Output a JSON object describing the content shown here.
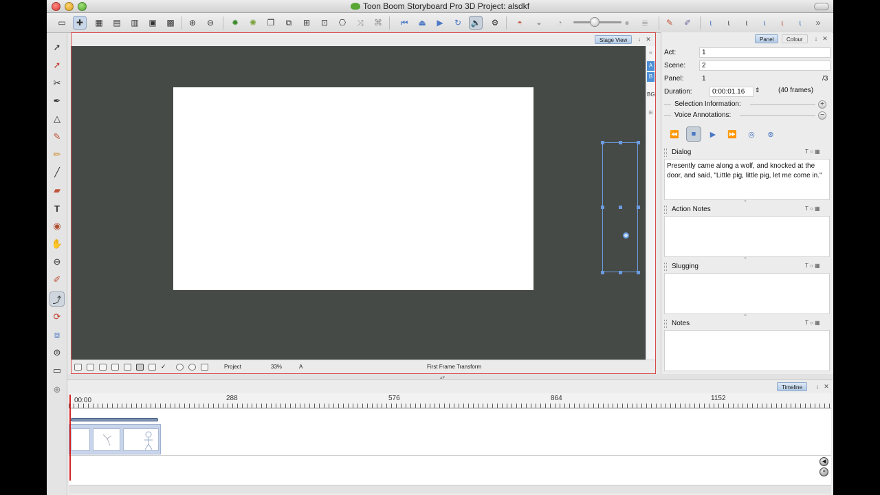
{
  "window": {
    "title": "Toon Boom Storyboard Pro 3D Project: alsdkf"
  },
  "stage_view": {
    "tab_label": "Stage View",
    "status": {
      "display": "Project",
      "zoom": "33%",
      "layer": "A",
      "transform_mode": "First Frame Transform"
    },
    "side_tabs": [
      "A",
      "B",
      "BG"
    ]
  },
  "right_panel": {
    "tabs": {
      "panel": "Panel",
      "colour": "Colour"
    },
    "fields": {
      "act_label": "Act:",
      "act_value": "1",
      "scene_label": "Scene:",
      "scene_value": "2",
      "panel_label": "Panel:",
      "panel_value": "1",
      "panel_total": "/3",
      "duration_label": "Duration:",
      "duration_value": "0:00:01.16",
      "frames_text": "(40 frames)"
    },
    "selection_information": "Selection Information:",
    "voice_annotations": "Voice Annotations:",
    "sections": {
      "dialog_title": "Dialog",
      "dialog_text": "Presently came along a wolf, and knocked at the door, and said, \"Little pig, little pig, let me come in.\"",
      "action_notes_title": "Action Notes",
      "slugging_title": "Slugging",
      "notes_title": "Notes"
    }
  },
  "timeline": {
    "tab_label": "Timeline",
    "start_time": "00:00",
    "ruler_marks": [
      "288",
      "576",
      "864",
      "1152"
    ]
  },
  "colors": {
    "viewport_bg": "#464a47",
    "accent_blue": "#6b9be0",
    "focus_border": "#d84a4a",
    "playhead": "#d32222"
  }
}
